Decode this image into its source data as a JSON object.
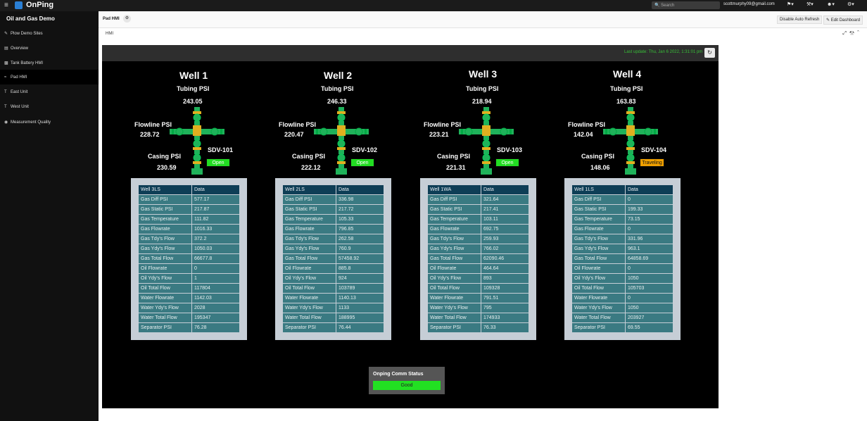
{
  "app": {
    "brand": "OnPing"
  },
  "topbar": {
    "search_placeholder": "Search",
    "user_email": "scottmurphy09@gmail.com"
  },
  "sidebar": {
    "title": "Oil and Gas Demo",
    "items": [
      {
        "label": "Plow Demo Sites",
        "icon": "link-icon"
      },
      {
        "label": "Overview",
        "icon": "monitor-icon"
      },
      {
        "label": "Tank Battery HMI",
        "icon": "tank-icon"
      },
      {
        "label": "Pad HMI",
        "icon": "pad-icon",
        "active": true
      },
      {
        "label": "East Unit",
        "icon": "t-icon"
      },
      {
        "label": "West Unit",
        "icon": "t-icon"
      },
      {
        "label": "Measurement Quality",
        "icon": "gauge-icon"
      }
    ]
  },
  "tabbar": {
    "tab_label": "Pad HMI",
    "disable_refresh_label": "Disable Auto Refresh",
    "edit_dashboard_label": "Edit Dashboard"
  },
  "subbar": {
    "label": "HMI"
  },
  "hmi": {
    "last_update": "Last update: Thu, Jan 6 2022, 1:31:01 pm",
    "labels": {
      "tubing": "Tubing PSI",
      "flowline": "Flowline PSI",
      "casing": "Casing PSI",
      "col_data": "Data"
    },
    "wells": [
      {
        "title": "Well 1",
        "tubing": "243.05",
        "flowline": "228.72",
        "casing": "230.59",
        "sdv": "SDV-101",
        "status": "Open",
        "status_color": "#22dd22",
        "table_name": "Well 3LS",
        "rows": [
          [
            "Gas Diff PSI",
            "577.17"
          ],
          [
            "Gas Static PSI",
            "217.87"
          ],
          [
            "Gas Temperature",
            "111.82"
          ],
          [
            "Gas Flowrate",
            "1016.33"
          ],
          [
            "Gas Tdy's Flow",
            "372.2"
          ],
          [
            "Gas Ydy's Flow",
            "1050.03"
          ],
          [
            "Gas Total Flow",
            "66677.8"
          ],
          [
            "Oil Flowrate",
            "0"
          ],
          [
            "Oil Ydy's Flow",
            "1"
          ],
          [
            "Oil Total Flow",
            "117804"
          ],
          [
            "Water Flowrate",
            "1142.03"
          ],
          [
            "Water Ydy's Flow",
            "2028"
          ],
          [
            "Water Total Flow",
            "195347"
          ],
          [
            "Separator PSI",
            "76.28"
          ]
        ]
      },
      {
        "title": "Well 2",
        "tubing": "246.33",
        "flowline": "220.47",
        "casing": "222.12",
        "sdv": "SDV-102",
        "status": "Open",
        "status_color": "#22dd22",
        "table_name": "Well 2LS",
        "rows": [
          [
            "Gas Diff PSI",
            "336.98"
          ],
          [
            "Gas Static PSI",
            "217.72"
          ],
          [
            "Gas Temperature",
            "105.33"
          ],
          [
            "Gas Flowrate",
            "796.85"
          ],
          [
            "Gas Tdy's Flow",
            "262.58"
          ],
          [
            "Gas Ydy's Flow",
            "760.9"
          ],
          [
            "Gas Total Flow",
            "57458.92"
          ],
          [
            "Oil Flowrate",
            "885.8"
          ],
          [
            "Oil Ydy's Flow",
            "924"
          ],
          [
            "Oil Total Flow",
            "103789"
          ],
          [
            "Water Flowrate",
            "1140.13"
          ],
          [
            "Water Ydy's Flow",
            "1133"
          ],
          [
            "Water Total Flow",
            "188995"
          ],
          [
            "Separator PSI",
            "76.44"
          ]
        ]
      },
      {
        "title": "Well 3",
        "tubing": "218.94",
        "flowline": "223.21",
        "casing": "221.31",
        "sdv": "SDV-103",
        "status": "Open",
        "status_color": "#22dd22",
        "table_name": "Well 1WA",
        "rows": [
          [
            "Gas Diff PSI",
            "321.64"
          ],
          [
            "Gas Static PSI",
            "217.41"
          ],
          [
            "Gas Temperature",
            "103.11"
          ],
          [
            "Gas Flowrate",
            "692.75"
          ],
          [
            "Gas Tdy's Flow",
            "259.93"
          ],
          [
            "Gas Ydy's Flow",
            "766.02"
          ],
          [
            "Gas Total Flow",
            "62090.46"
          ],
          [
            "Oil Flowrate",
            "464.64"
          ],
          [
            "Oil Ydy's Flow",
            "893"
          ],
          [
            "Oil Total Flow",
            "109328"
          ],
          [
            "Water Flowrate",
            "791.51"
          ],
          [
            "Water Ydy's Flow",
            "795"
          ],
          [
            "Water Total Flow",
            "174933"
          ],
          [
            "Separator PSI",
            "76.33"
          ]
        ]
      },
      {
        "title": "Well 4",
        "tubing": "163.83",
        "flowline": "142.04",
        "casing": "148.06",
        "sdv": "SDV-104",
        "status": "Traveling",
        "status_color": "#f0a000",
        "table_name": "Well 1LS",
        "rows": [
          [
            "Gas Diff PSI",
            "0"
          ],
          [
            "Gas Static PSI",
            "199.33"
          ],
          [
            "Gas Temperature",
            "73.15"
          ],
          [
            "Gas Flowrate",
            "0"
          ],
          [
            "Gas Tdy's Flow",
            "331.96"
          ],
          [
            "Gas Ydy's Flow",
            "963.1"
          ],
          [
            "Gas Total Flow",
            "64858.69"
          ],
          [
            "Oil Flowrate",
            "0"
          ],
          [
            "Oil Ydy's Flow",
            "1050"
          ],
          [
            "Oil Total Flow",
            "105703"
          ],
          [
            "Water Flowrate",
            "0"
          ],
          [
            "Water Ydy's Flow",
            "1050"
          ],
          [
            "Water Total Flow",
            "203927"
          ],
          [
            "Separator PSI",
            "69.55"
          ]
        ]
      }
    ],
    "comm": {
      "title": "Onping Comm Status",
      "status": "Good",
      "status_color": "#22e022"
    }
  }
}
